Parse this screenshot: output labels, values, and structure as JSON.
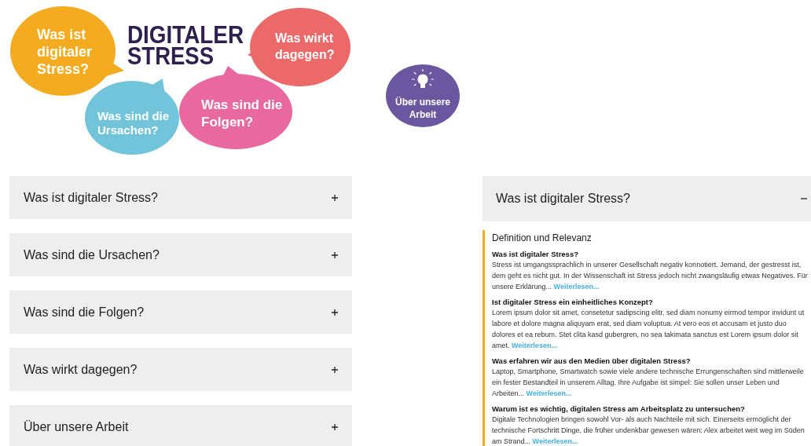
{
  "header": {
    "title_lines": [
      "DIGITALER",
      "STRESS"
    ],
    "bubbles": [
      {
        "lines": [
          "Was ist",
          "digitaler",
          "Stress?"
        ],
        "color": "#f5ab1f"
      },
      {
        "lines": [
          "Was sind die",
          "Ursachen?"
        ],
        "color": "#72c4da"
      },
      {
        "lines": [
          "Was sind die",
          "Folgen?"
        ],
        "color": "#e8689f"
      },
      {
        "lines": [
          "Was wirkt",
          "dagegen?"
        ],
        "color": "#eb6a69"
      }
    ],
    "about_badge": {
      "lines": [
        "Über unsere",
        "Arbeit"
      ]
    }
  },
  "accordion": [
    {
      "label": "Was ist digitaler Stress?",
      "expanded": false
    },
    {
      "label": "Was sind die Ursachen?",
      "expanded": false
    },
    {
      "label": "Was sind die Folgen?",
      "expanded": false
    },
    {
      "label": "Was wirkt dagegen?",
      "expanded": false
    },
    {
      "label": "Über unsere Arbeit",
      "expanded": false
    }
  ],
  "open_panel": {
    "label": "Was ist digitaler Stress?",
    "expanded": true,
    "subtitle": "Definition und Relevanz",
    "sections": [
      {
        "heading": "Was ist digitaler Stress?",
        "text": "Stress ist umgangssprachlich in unserer Gesellschaft negativ konnotiert. Jemand, der gestresst ist, dem geht es nicht gut. In der Wissenschaft ist Stress jedoch nicht zwangsläufig etwas Negatives. Für unsere Erklärung...",
        "link": "Weiterlesen..."
      },
      {
        "heading": "Ist digitaler Stress ein einheitliches Konzept?",
        "text": "Lorem ipsum dolor sit amet, consetetur sadipscing elitr, sed diam nonumy eirmod tempor invidunt ut labore et dolore magna aliquyam erat, sed diam voluptua. At vero eos et accusam et justo duo dolores et ea rebum. Stet clita kasd gubergren, no sea takimata sanctus est Lorem ipsum dolor sit amet.",
        "link": "Weiterlesen..."
      },
      {
        "heading": "Was erfahren wir aus den Medien über digitalen Stress?",
        "text": "Laptop, Smartphone, Smartwatch sowie viele andere technische Errungenschaften sind mittlerweile ein fester Bestandteil in unserem Alltag. Ihre Aufgabe ist simpel: Sie sollen unser Leben und Arbeiten...",
        "link": "Weiterlesen..."
      },
      {
        "heading": "Warum ist es wichtig, digitalen Stress am Arbeitsplatz zu untersuchen?",
        "text": "Digitale Technologien bringen sowohl Vor- als auch Nachteile mit sich. Einerseits ermöglicht der technische Fortschritt Dinge, die früher undenkbar gewesen wären: Alex arbeitet weit weg im Süden am Strand...",
        "link": "Weiterlesen..."
      }
    ]
  }
}
